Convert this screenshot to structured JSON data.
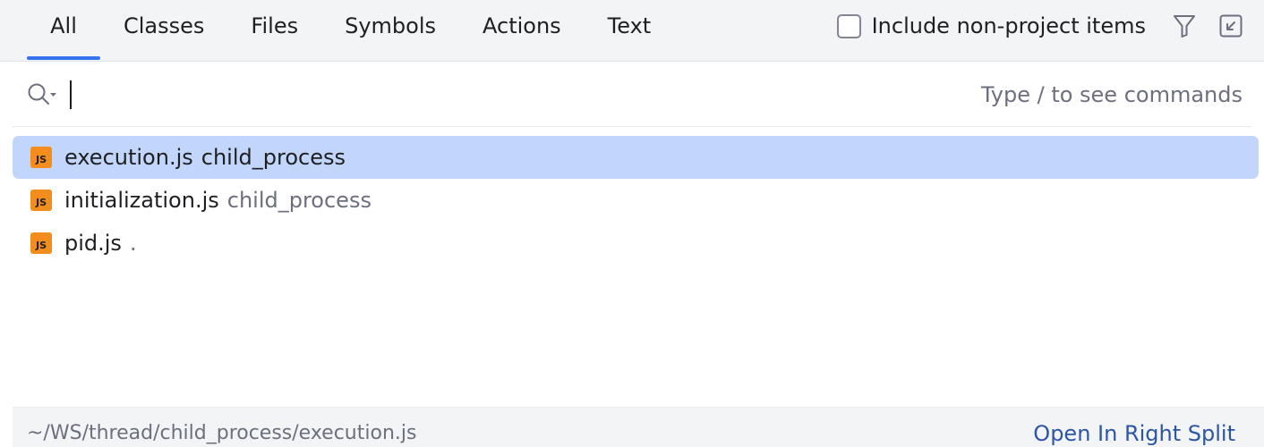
{
  "tabs": [
    {
      "label": "All",
      "selected": true
    },
    {
      "label": "Classes",
      "selected": false
    },
    {
      "label": "Files",
      "selected": false
    },
    {
      "label": "Symbols",
      "selected": false
    },
    {
      "label": "Actions",
      "selected": false
    },
    {
      "label": "Text",
      "selected": false
    }
  ],
  "options": {
    "include_non_project_label": "Include non-project items",
    "include_non_project_checked": false,
    "filter_icon": "filter-icon",
    "collapse_icon": "collapse-to-corner-icon"
  },
  "search": {
    "icon": "search-icon",
    "value": "",
    "hint": "Type / to see commands"
  },
  "results": [
    {
      "icon": "js-file-icon",
      "icon_text": "JS",
      "name": "execution.js",
      "location": "child_process",
      "selected": true
    },
    {
      "icon": "js-file-icon",
      "icon_text": "JS",
      "name": "initialization.js",
      "location": "child_process",
      "selected": false
    },
    {
      "icon": "js-file-icon",
      "icon_text": "JS",
      "name": "pid.js",
      "location": ".",
      "selected": false
    }
  ],
  "footer": {
    "path": "~/WS/thread/child_process/execution.js",
    "action_label": "Open In Right Split"
  },
  "colors": {
    "accent": "#3574f0",
    "selection": "#c2d6fc",
    "js_icon": "#f28d1e",
    "link": "#2e55a3"
  }
}
